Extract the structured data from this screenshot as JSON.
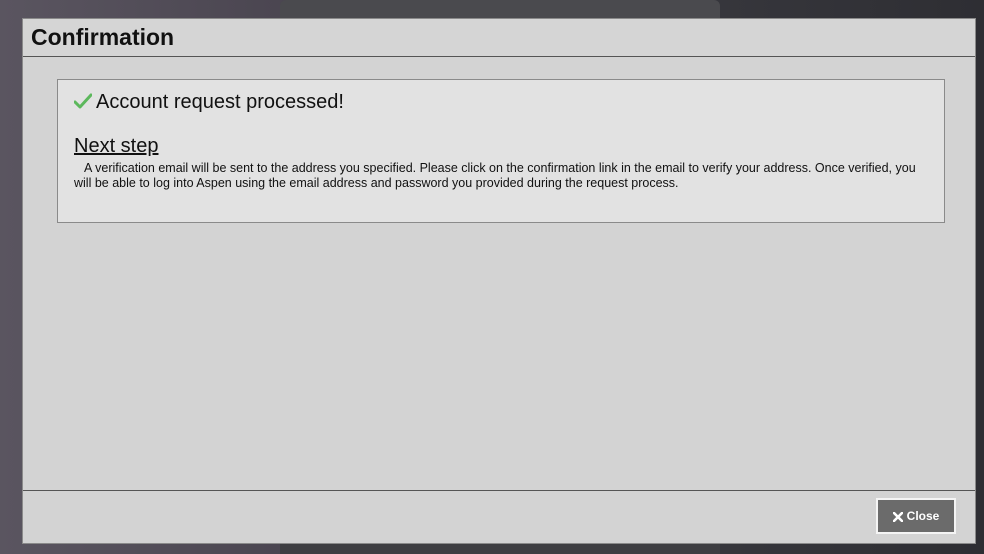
{
  "dialog": {
    "title": "Confirmation"
  },
  "message": {
    "success_text": "Account request processed!",
    "success_icon": "check-icon",
    "success_icon_color": "#5cb85c",
    "next_step_heading": "Next step",
    "next_step_body": "A verification email will be sent to the address you specified. Please click on the confirmation link in the email to verify your address. Once verified, you will be able to log into Aspen using the email address and password you provided during the request process."
  },
  "footer": {
    "close_label": "Close",
    "close_icon": "close-icon"
  }
}
